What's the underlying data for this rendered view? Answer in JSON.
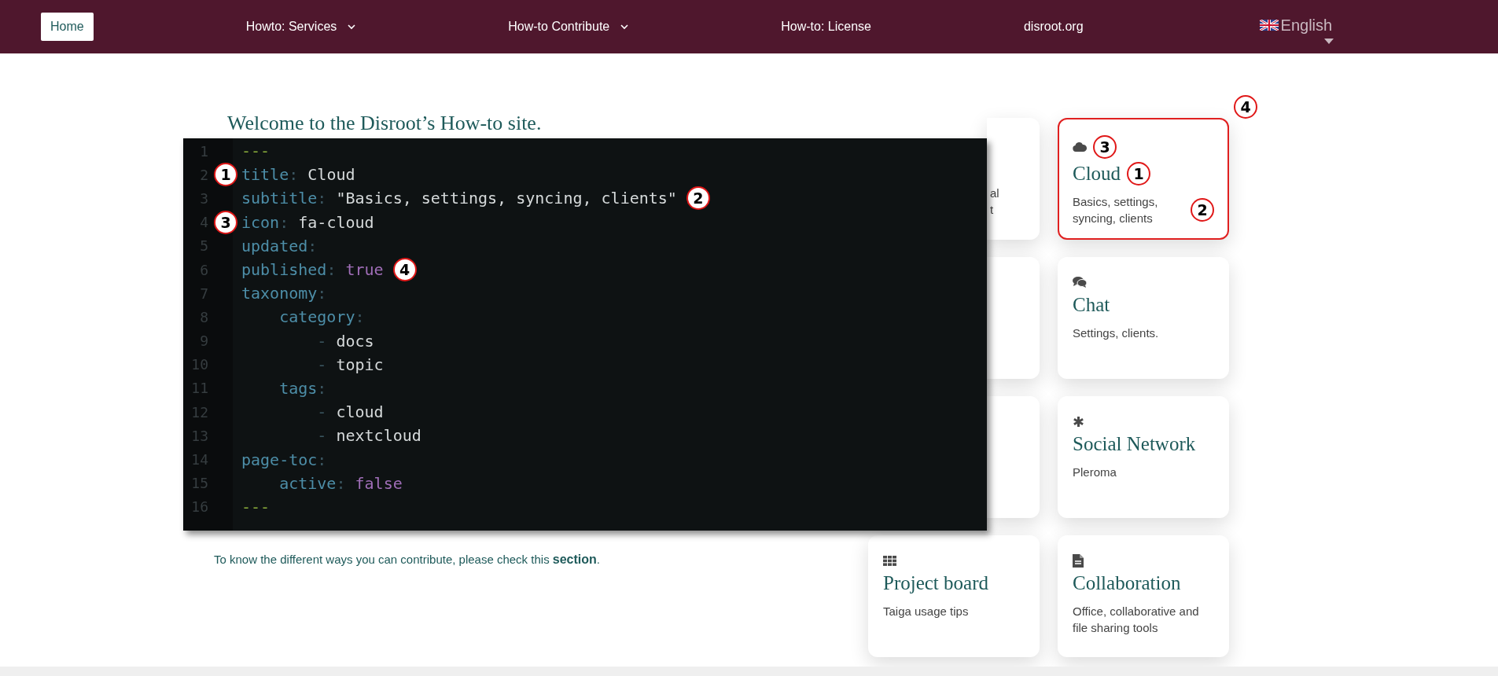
{
  "nav": {
    "items": [
      {
        "label": "Home",
        "selected": true,
        "dropdown": false
      },
      {
        "label": "Howto: Services",
        "selected": false,
        "dropdown": true
      },
      {
        "label": "How-to Contribute",
        "selected": false,
        "dropdown": true
      },
      {
        "label": "How-to: License",
        "selected": false,
        "dropdown": false
      },
      {
        "label": "disroot.org",
        "selected": false,
        "dropdown": false
      }
    ],
    "language": {
      "label": "English"
    }
  },
  "heading": "Welcome to the Disroot’s How-to site.",
  "code": {
    "lines": [
      {
        "number": "1",
        "tokens": [
          {
            "text": "---",
            "kind": "marker"
          }
        ]
      },
      {
        "number": "2",
        "tokens": [
          {
            "text": "title",
            "kind": "key"
          },
          {
            "text": ": ",
            "kind": "punct"
          },
          {
            "text": "Cloud",
            "kind": "value"
          }
        ],
        "callout_before": "1"
      },
      {
        "number": "3",
        "tokens": [
          {
            "text": "subtitle",
            "kind": "key"
          },
          {
            "text": ": ",
            "kind": "punct"
          },
          {
            "text": "\"Basics, settings, syncing, clients\"",
            "kind": "value"
          }
        ],
        "callout_after": "2"
      },
      {
        "number": "4",
        "tokens": [
          {
            "text": "icon",
            "kind": "key"
          },
          {
            "text": ": ",
            "kind": "punct"
          },
          {
            "text": "fa-cloud",
            "kind": "value"
          }
        ],
        "callout_before": "3"
      },
      {
        "number": "5",
        "tokens": [
          {
            "text": "updated",
            "kind": "key"
          },
          {
            "text": ":",
            "kind": "punct"
          }
        ]
      },
      {
        "number": "6",
        "tokens": [
          {
            "text": "published",
            "kind": "key"
          },
          {
            "text": ": ",
            "kind": "punct"
          },
          {
            "text": "true",
            "kind": "bool"
          }
        ],
        "callout_after": "4"
      },
      {
        "number": "7",
        "tokens": [
          {
            "text": "taxonomy",
            "kind": "key"
          },
          {
            "text": ":",
            "kind": "punct"
          }
        ]
      },
      {
        "number": "8",
        "tokens": [
          {
            "text": "    category",
            "kind": "key"
          },
          {
            "text": ":",
            "kind": "punct"
          }
        ]
      },
      {
        "number": "9",
        "tokens": [
          {
            "text": "        - ",
            "kind": "punct"
          },
          {
            "text": "docs",
            "kind": "value"
          }
        ]
      },
      {
        "number": "10",
        "tokens": [
          {
            "text": "        - ",
            "kind": "punct"
          },
          {
            "text": "topic",
            "kind": "value"
          }
        ]
      },
      {
        "number": "11",
        "tokens": [
          {
            "text": "    tags",
            "kind": "key"
          },
          {
            "text": ":",
            "kind": "punct"
          }
        ]
      },
      {
        "number": "12",
        "tokens": [
          {
            "text": "        - ",
            "kind": "punct"
          },
          {
            "text": "cloud",
            "kind": "value"
          }
        ]
      },
      {
        "number": "13",
        "tokens": [
          {
            "text": "        - ",
            "kind": "punct"
          },
          {
            "text": "nextcloud",
            "kind": "value"
          }
        ]
      },
      {
        "number": "14",
        "tokens": [
          {
            "text": "page-toc",
            "kind": "key"
          },
          {
            "text": ":",
            "kind": "punct"
          }
        ]
      },
      {
        "number": "15",
        "tokens": [
          {
            "text": "    active",
            "kind": "key"
          },
          {
            "text": ": ",
            "kind": "punct"
          },
          {
            "text": "false",
            "kind": "bool"
          }
        ]
      },
      {
        "number": "16",
        "tokens": [
          {
            "text": "---",
            "kind": "marker"
          }
        ]
      }
    ]
  },
  "paragraph": {
    "text": "To know the different ways you can contribute, please check this ",
    "link": "section",
    "after": "."
  },
  "cards": [
    {
      "kind": "covered",
      "fragments": [
        "al",
        "t"
      ]
    },
    {
      "kind": "card",
      "title": "Cloud",
      "description": "Basics, settings, syncing, clients",
      "highlighted": true,
      "callouts": {
        "icon": "3",
        "title": "1",
        "description": "2",
        "card": "4"
      }
    },
    {
      "kind": "covered"
    },
    {
      "kind": "card",
      "title": "Chat",
      "description": "Settings, clients.",
      "highlighted": false
    },
    {
      "kind": "covered"
    },
    {
      "kind": "card",
      "title": "Social Network",
      "description": "Pleroma",
      "highlighted": false
    },
    {
      "kind": "card",
      "title": "Project board",
      "description": "Taiga usage tips",
      "highlighted": false
    },
    {
      "kind": "card",
      "title": "Collaboration",
      "description": "Office, collaborative and file sharing tools",
      "highlighted": false
    }
  ]
}
